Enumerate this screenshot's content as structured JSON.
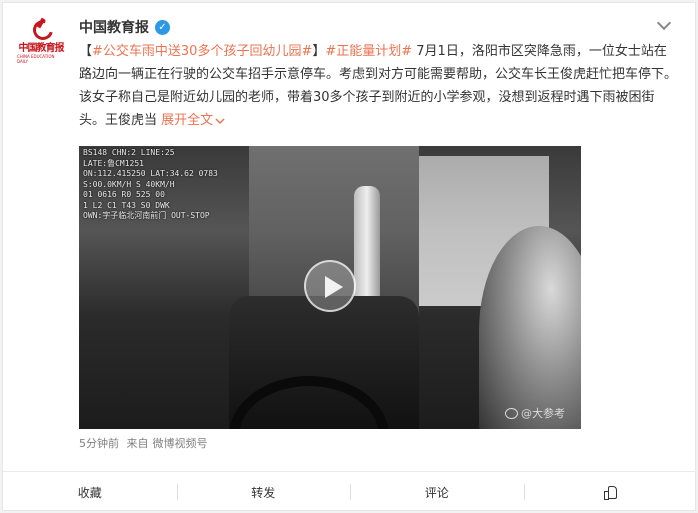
{
  "post": {
    "author": "中国教育报",
    "avatar_text": "中国教育报",
    "avatar_sub": "CHINA EDUCATION DAILY",
    "verified_glyph": "✓",
    "text_parts": {
      "bracket_open": "【",
      "tag1": "#公交车雨中送30多个孩子回幼儿园#",
      "bracket_close": "】",
      "tag2": "#正能量计划#",
      "body": " 7月1日，洛阳市区突降急雨，一位女士站在路边向一辆正在行驶的公交车招手示意停车。考虑到对方可能需要帮助，公交车长王俊虎赶忙把车停下。该女子称自己是附近幼儿园的老师，带着30多个孩子到附近的小学参观，没想到返程时遇下雨被困街头。王俊虎当 ",
      "expand": "展开全文",
      "expand_icon": "chevron-down-icon"
    },
    "video": {
      "overlay_left": "BS148 CHN:2 LINE:25\nLATE:鲁CM1251\nON:112.415250 LAT:34.62 0783\nS:00.0KM/H S 40KM/H\n01 0616 R0 525 00\n1 L2 C1 T43 S0 DWK\nOWN:字子临北河南前门 OUT-STOP",
      "watermark": "@大参考",
      "play_icon": "play-icon"
    },
    "time": "5分钟前",
    "source_prefix": "来自",
    "source": "微博视频号"
  },
  "actions": {
    "favorite": "收藏",
    "repost": "转发",
    "comment": "评论",
    "like_icon": "thumbs-up-icon"
  },
  "colors": {
    "link": "#eb7350",
    "brand_red": "#c8161d",
    "verified_blue": "#2d98e6"
  }
}
